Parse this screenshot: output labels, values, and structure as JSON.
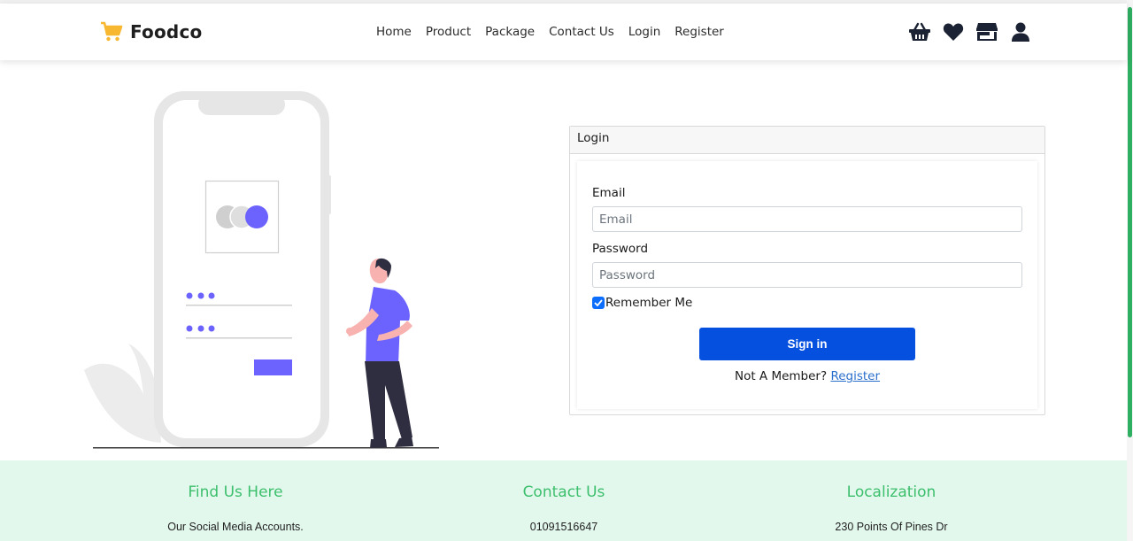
{
  "brand": {
    "name": "Foodco",
    "icon": "cart-icon",
    "accent": "#f7b731"
  },
  "nav": {
    "links": [
      "Home",
      "Product",
      "Package",
      "Contact Us",
      "Login",
      "Register"
    ],
    "icons": [
      "basket-icon",
      "heart-icon",
      "store-icon",
      "user-icon"
    ]
  },
  "login": {
    "header": "Login",
    "email_label": "Email",
    "email_placeholder": "Email",
    "email_value": "",
    "password_label": "Password",
    "password_placeholder": "Password",
    "password_value": "",
    "remember_label": "Remember Me",
    "remember_checked": true,
    "signin_label": "Sign in",
    "member_text": "Not A Member?",
    "register_link": "Register"
  },
  "footer": {
    "columns": [
      {
        "title": "Find Us Here",
        "text": "Our Social Media Accounts."
      },
      {
        "title": "Contact Us",
        "text": "01091516647"
      },
      {
        "title": "Localization",
        "text": "230 Points Of Pines Dr"
      }
    ]
  },
  "colors": {
    "primary_button": "#0650e0",
    "illustration_accent": "#6c63ff",
    "footer_bg": "#e3f8ec",
    "footer_title": "#3cbf6d",
    "scrollbar": "#2eaf62"
  }
}
